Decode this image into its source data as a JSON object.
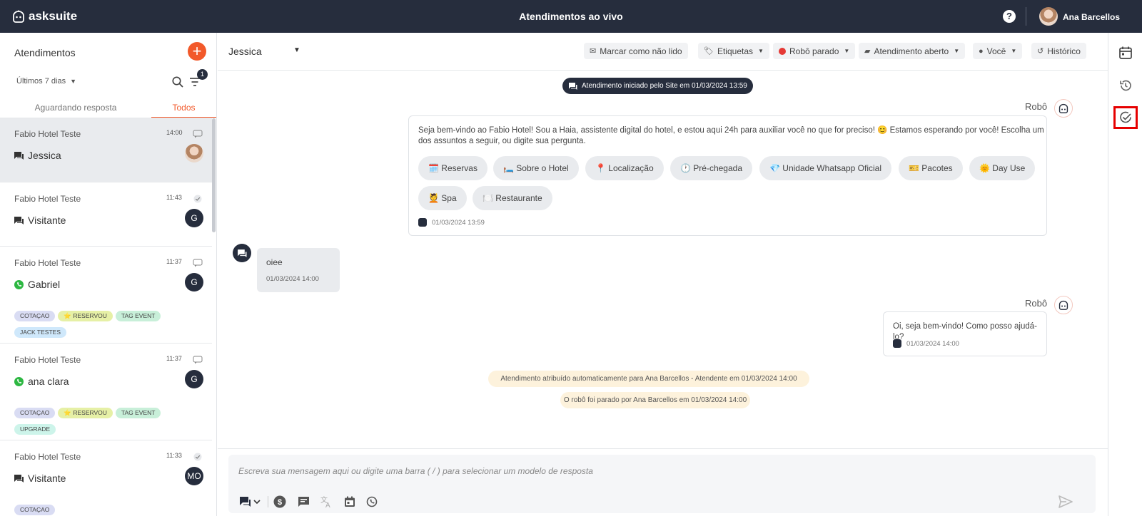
{
  "topbar": {
    "logo": "asksuite",
    "title": "Atendimentos ao vivo",
    "help": "?",
    "user": "Ana Barcellos"
  },
  "sidebar": {
    "title": "Atendimentos",
    "add_label": "+",
    "period": "Últimos 7 dias",
    "filter_count": "1",
    "tabs": [
      "Aguardando resposta",
      "Todos"
    ],
    "conversations": [
      {
        "hotel": "Fabio Hotel Teste",
        "time": "14:00",
        "name": "Jessica",
        "channel": "chat-icon",
        "avatar": "",
        "tags": []
      },
      {
        "hotel": "Fabio Hotel Teste",
        "time": "11:43",
        "name": "Visitante",
        "channel": "chat-icon",
        "avatar": "G",
        "tags": []
      },
      {
        "hotel": "Fabio Hotel Teste",
        "time": "11:37",
        "name": "Gabriel",
        "channel": "whatsapp-icon",
        "avatar": "G",
        "tags": [
          "COTAÇAO",
          "⭐ RESERVOU",
          "TAG EVENT",
          "JACK TESTES"
        ]
      },
      {
        "hotel": "Fabio Hotel Teste",
        "time": "11:37",
        "name": "ana clara",
        "channel": "whatsapp-icon",
        "avatar": "G",
        "tags": [
          "COTAÇAO",
          "⭐ RESERVOU",
          "TAG EVENT",
          "UPGRADE"
        ]
      },
      {
        "hotel": "Fabio Hotel Teste",
        "time": "11:33",
        "name": "Visitante",
        "channel": "chat-icon",
        "avatar": "MO",
        "tags": [
          "COTAÇAO"
        ]
      }
    ]
  },
  "chat": {
    "contact": "Jessica",
    "actions": {
      "unread": "Marcar como não lido",
      "labels": "Etiquetas",
      "robot": "Robô parado",
      "status": "Atendimento aberto",
      "assignee": "Você",
      "history": "Histórico"
    },
    "started": "Atendimento iniciado pelo Site em 01/03/2024 13:59",
    "robot_label": "Robô",
    "bot_message": "Seja bem-vindo ao Fabio Hotel! Sou a Haia, assistente digital do hotel, e estou aqui 24h para auxiliar você no que for preciso! 😊 Estamos esperando por você! Escolha um dos assuntos a seguir, ou digite sua pergunta.",
    "quick_replies": [
      "🗓️ Reservas",
      "🛏️ Sobre o Hotel",
      "📍 Localização",
      "🕐 Pré-chegada",
      "💎 Unidade Whatsapp Oficial",
      "🎫 Pacotes",
      "🌞 Day Use",
      "💆 Spa",
      "🍽️ Restaurante"
    ],
    "bot_timestamp": "01/03/2024 13:59",
    "user_message": "oiee",
    "user_timestamp": "01/03/2024 14:00",
    "bot_reply": "Oi, seja bem-vindo! Como posso ajudá-lo?",
    "bot_reply_timestamp": "01/03/2024 14:00",
    "notice_assigned": "Atendimento atribuído automaticamente para Ana Barcellos - Atendente em 01/03/2024 14:00",
    "notice_stopped": "O robô foi parado por Ana Barcellos em 01/03/2024 14:00",
    "composer_placeholder": "Escreva sua mensagem aqui ou digite uma barra ( / ) para selecionar um modelo de resposta"
  },
  "colors": {
    "topbar": "#262d3d",
    "accent": "#f2592a",
    "highlight": "#e60000"
  }
}
